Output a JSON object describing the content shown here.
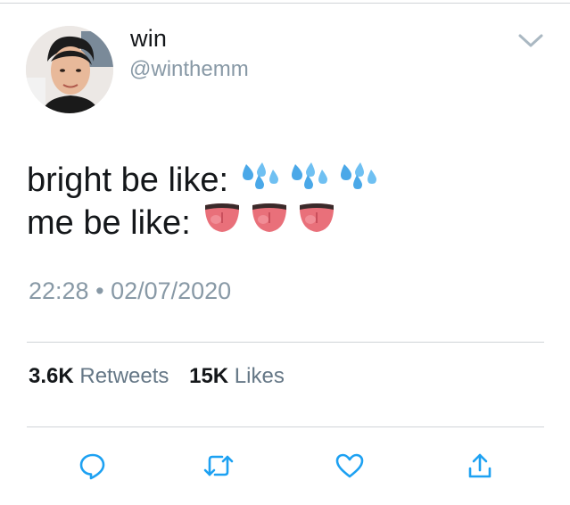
{
  "user": {
    "display_name": "win",
    "handle": "@winthemm",
    "avatar_icon": "profile-photo"
  },
  "tweet": {
    "line1_text": "bright be like:",
    "line1_emoji": [
      "sweat-droplets-emoji",
      "sweat-droplets-emoji",
      "sweat-droplets-emoji"
    ],
    "line2_text": "me be like:",
    "line2_emoji": [
      "tongue-emoji",
      "tongue-emoji",
      "tongue-emoji"
    ]
  },
  "meta": {
    "time": "22:28",
    "separator": "•",
    "date": "02/07/2020"
  },
  "stats": {
    "retweets_count": "3.6K",
    "retweets_label": "Retweets",
    "likes_count": "15K",
    "likes_label": "Likes"
  },
  "actions": [
    "reply-icon",
    "retweet-icon",
    "like-icon",
    "share-icon"
  ],
  "colors": {
    "text": "#14171a",
    "muted": "#8899a6",
    "icon": "#1da1f2",
    "divider": "#d0d4d8"
  }
}
